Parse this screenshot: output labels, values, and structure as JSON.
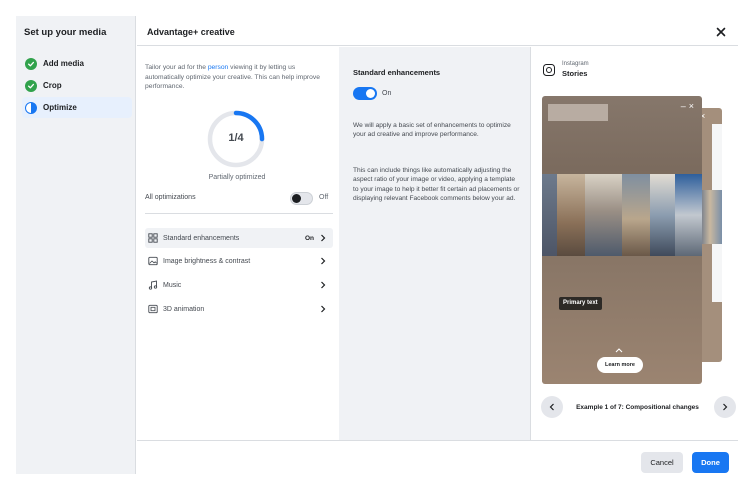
{
  "sidebar": {
    "title": "Set up your media",
    "items": [
      {
        "label": "Add media",
        "status": "complete",
        "icon": "check-circle-icon"
      },
      {
        "label": "Crop",
        "status": "complete",
        "icon": "check-circle-icon"
      },
      {
        "label": "Optimize",
        "status": "in-progress",
        "icon": "half-circle-icon"
      }
    ]
  },
  "header": {
    "title": "Advantage+ creative",
    "close_icon": "close-icon"
  },
  "optimize": {
    "intro_before": "Tailor your ad for the ",
    "intro_link": "person",
    "intro_after": " viewing it by letting us automatically optimize your creative. This can help improve performance.",
    "progress_label": "1/4",
    "progress_fraction": 0.25,
    "status_text": "Partially optimized",
    "all_label": "All optimizations",
    "all_state": "Off",
    "options": [
      {
        "label": "Standard enhancements",
        "state": "On",
        "icon": "grid-icon"
      },
      {
        "label": "Image brightness & contrast",
        "state": "",
        "icon": "image-icon"
      },
      {
        "label": "Music",
        "state": "",
        "icon": "music-icon"
      },
      {
        "label": "3D animation",
        "state": "",
        "icon": "3d-icon"
      }
    ]
  },
  "details": {
    "title": "Standard enhancements",
    "toggle_state": "On",
    "paragraph1": "We will apply a basic set of enhancements to optimize your ad creative and improve performance.",
    "paragraph2": "This can include things like automatically adjusting the aspect ratio of your image or video, applying a template to your image to help it better fit certain ad placements or displaying relevant Facebook comments below your ad."
  },
  "preview": {
    "platform": "Instagram",
    "placement": "Stories",
    "primary_text": "Primary text",
    "cta": "Learn more",
    "example_label": "Example 1 of 7: Compositional changes"
  },
  "footer": {
    "cancel": "Cancel",
    "done": "Done"
  },
  "colors": {
    "accent": "#1877f2",
    "success": "#31a24c",
    "panel_bg": "#f0f2f5"
  }
}
